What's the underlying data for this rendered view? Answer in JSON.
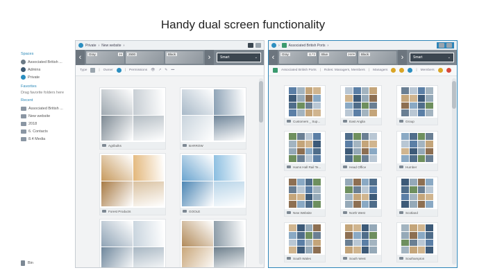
{
  "headline": "Handy dual screen functionality",
  "sidebar": {
    "sections": [
      {
        "heading": "Spaces",
        "items": [
          {
            "label": "Associated British ...",
            "icon": "avatar-icon",
            "color": "#6b7a86"
          },
          {
            "label": "Admins",
            "icon": "space-icon",
            "color": "#3e5a73"
          },
          {
            "label": "Private",
            "icon": "private-space-icon",
            "color": "#2b8ec0"
          }
        ]
      },
      {
        "heading": "Favorites",
        "note": "Drag favorite folders here"
      },
      {
        "heading": "Recent",
        "items": [
          {
            "label": "Associated British ...",
            "icon": "folder-icon"
          },
          {
            "label": "New website",
            "icon": "folder-icon"
          },
          {
            "label": "2018",
            "icon": "folder-icon"
          },
          {
            "label": "6. Contacts",
            "icon": "folder-icon"
          },
          {
            "label": "8.4 Media",
            "icon": "folder-icon"
          }
        ]
      }
    ],
    "bottom_label": "Bin"
  },
  "left_pane": {
    "breadcrumb": [
      "Private",
      "New website"
    ],
    "carousel": [
      {
        "label": "Gray",
        "count": "26"
      },
      {
        "label": "2500",
        "count": ""
      },
      {
        "label": "Black",
        "count": ""
      }
    ],
    "view_select": "Smart",
    "filters": {
      "type": "Type",
      "owner": "Owner",
      "permissions": "Permissions"
    },
    "cards": [
      {
        "label": "Agribulks",
        "col": 0,
        "row": 0,
        "photos": [
          "#9fa9b1",
          "#c5ccd2",
          "#7e8a94",
          "#b3bcc3"
        ]
      },
      {
        "label": "BARROW",
        "col": 1,
        "row": 0,
        "photos": [
          "#a8b9c8",
          "#8aa0b4",
          "#c9d4dd",
          "#6f8599"
        ]
      },
      {
        "label": "Forest Products",
        "col": 0,
        "row": 1,
        "photos": [
          "#c79a5e",
          "#e3b77a",
          "#a87b45",
          "#d9c1a0"
        ]
      },
      {
        "label": "GOOLE",
        "col": 1,
        "row": 1,
        "photos": [
          "#6aa4cf",
          "#89bde0",
          "#4c86b4",
          "#b7d4e8"
        ]
      },
      {
        "label": "GRIMSBY",
        "col": 0,
        "row": 2,
        "photos": [
          "#90a4b6",
          "#c7d3dd",
          "#6f879c",
          "#a7b6c2"
        ]
      },
      {
        "label": "HULL",
        "col": 1,
        "row": 2,
        "photos": [
          "#b18a5a",
          "#8a9aa6",
          "#c9a77b",
          "#6d7f8c"
        ]
      }
    ]
  },
  "right_pane": {
    "breadcrumb": [
      "Associated British Ports"
    ],
    "carousel": [
      {
        "label": "Gray",
        "count": "1172"
      },
      {
        "label": "Blue",
        "count": "2609"
      },
      {
        "label": "Black",
        "count": ""
      }
    ],
    "view_select": "Smart",
    "filters": {
      "space": "Associated British Ports",
      "roles": "Roles: Managers, Members",
      "managers": "Managers",
      "members": "Members"
    },
    "cards": [
      {
        "label": "Customers _ Sup...",
        "col": 0,
        "row": 0
      },
      {
        "label": "East Anglia",
        "col": 1,
        "row": 0
      },
      {
        "label": "Group",
        "col": 2,
        "row": 0
      },
      {
        "label": "Hams Hall Rail Te...",
        "col": 0,
        "row": 1
      },
      {
        "label": "Head Office",
        "col": 1,
        "row": 1
      },
      {
        "label": "Humber",
        "col": 2,
        "row": 1
      },
      {
        "label": "New Website",
        "col": 0,
        "row": 2
      },
      {
        "label": "North West",
        "col": 1,
        "row": 2
      },
      {
        "label": "Scotland",
        "col": 2,
        "row": 2
      },
      {
        "label": "South Wales",
        "col": 0,
        "row": 3
      },
      {
        "label": "South West",
        "col": 1,
        "row": 3
      },
      {
        "label": "Southampton",
        "col": 2,
        "row": 3
      }
    ]
  },
  "colors": {
    "accent": "#2d85b8",
    "pane_bg": "#f2f3f4",
    "carousel_bg": "#7d8790"
  }
}
